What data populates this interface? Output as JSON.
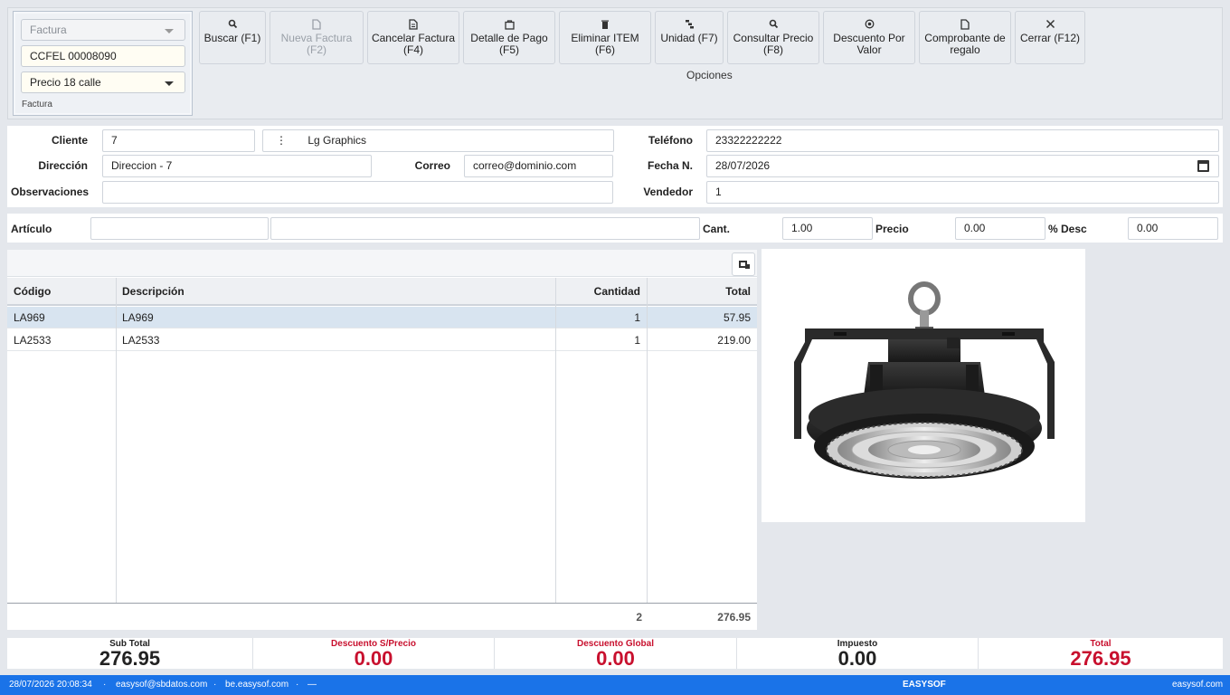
{
  "factura_group": {
    "doc_type": "Factura",
    "serial": "CCFEL 00008090",
    "price_list": "Precio 18 calle",
    "group_label": "Factura"
  },
  "toolbar": {
    "buscar": "Buscar (F1)",
    "nueva": "Nueva Factura (F2)",
    "cancelar": "Cancelar Factura (F4)",
    "detalle_pago": "Detalle de Pago (F5)",
    "eliminar": "Eliminar ITEM (F6)",
    "unidad": "Unidad (F7)",
    "consultar": "Consultar Precio (F8)",
    "descuento_valor": "Descuento Por Valor",
    "comprobante": "Comprobante de regalo",
    "cerrar": "Cerrar (F12)",
    "group_label": "Opciones"
  },
  "client": {
    "cliente_label": "Cliente",
    "cliente_code": "7",
    "lookup_icon": "⋮",
    "cliente_name": "Lg Graphics",
    "telefono_label": "Teléfono",
    "telefono": "23322222222",
    "direccion_label": "Dirección",
    "direccion": "Direccion - 7",
    "correo_label": "Correo",
    "correo": "correo@dominio.com",
    "fecha_label": "Fecha N.",
    "fecha": "28/07/2026",
    "observaciones_label": "Observaciones",
    "observaciones": "",
    "vendedor_label": "Vendedor",
    "vendedor": "1"
  },
  "article": {
    "articulo_label": "Artículo",
    "codigo": "",
    "descripcion": "",
    "cant_label": "Cant.",
    "cant": "1.00",
    "precio_label": "Precio",
    "precio": "0.00",
    "desc_label": "% Desc",
    "desc": "0.00"
  },
  "grid": {
    "headers": {
      "codigo": "Código",
      "descripcion": "Descripción",
      "cantidad": "Cantidad",
      "total": "Total"
    },
    "rows": [
      {
        "codigo": "LA969",
        "descripcion": "LA969",
        "cantidad": "1",
        "total": "57.95"
      },
      {
        "codigo": "LA2533",
        "descripcion": "LA2533",
        "cantidad": "1",
        "total": "219.00"
      }
    ],
    "footer_cantidad": "2",
    "footer_total": "276.95"
  },
  "totals": {
    "subtotal_label": "Sub Total",
    "subtotal": "276.95",
    "desc_precio_label": "Descuento S/Precio",
    "desc_precio": "0.00",
    "desc_global_label": "Descuento Global",
    "desc_global": "0.00",
    "impuesto_label": "Impuesto",
    "impuesto": "0.00",
    "total_label": "Total",
    "total": "276.95"
  },
  "statusbar": {
    "datetime": "28/07/2026 20:08:34",
    "email": "easysof@sbdatos.com",
    "server": "be.easysof.com",
    "dash": "—",
    "brand": "EASYSOF",
    "site": "easysof.com"
  },
  "colors": {
    "accent": "#1a73e8",
    "total_red": "#c8102e",
    "selected_row": "#d8e4f0"
  }
}
